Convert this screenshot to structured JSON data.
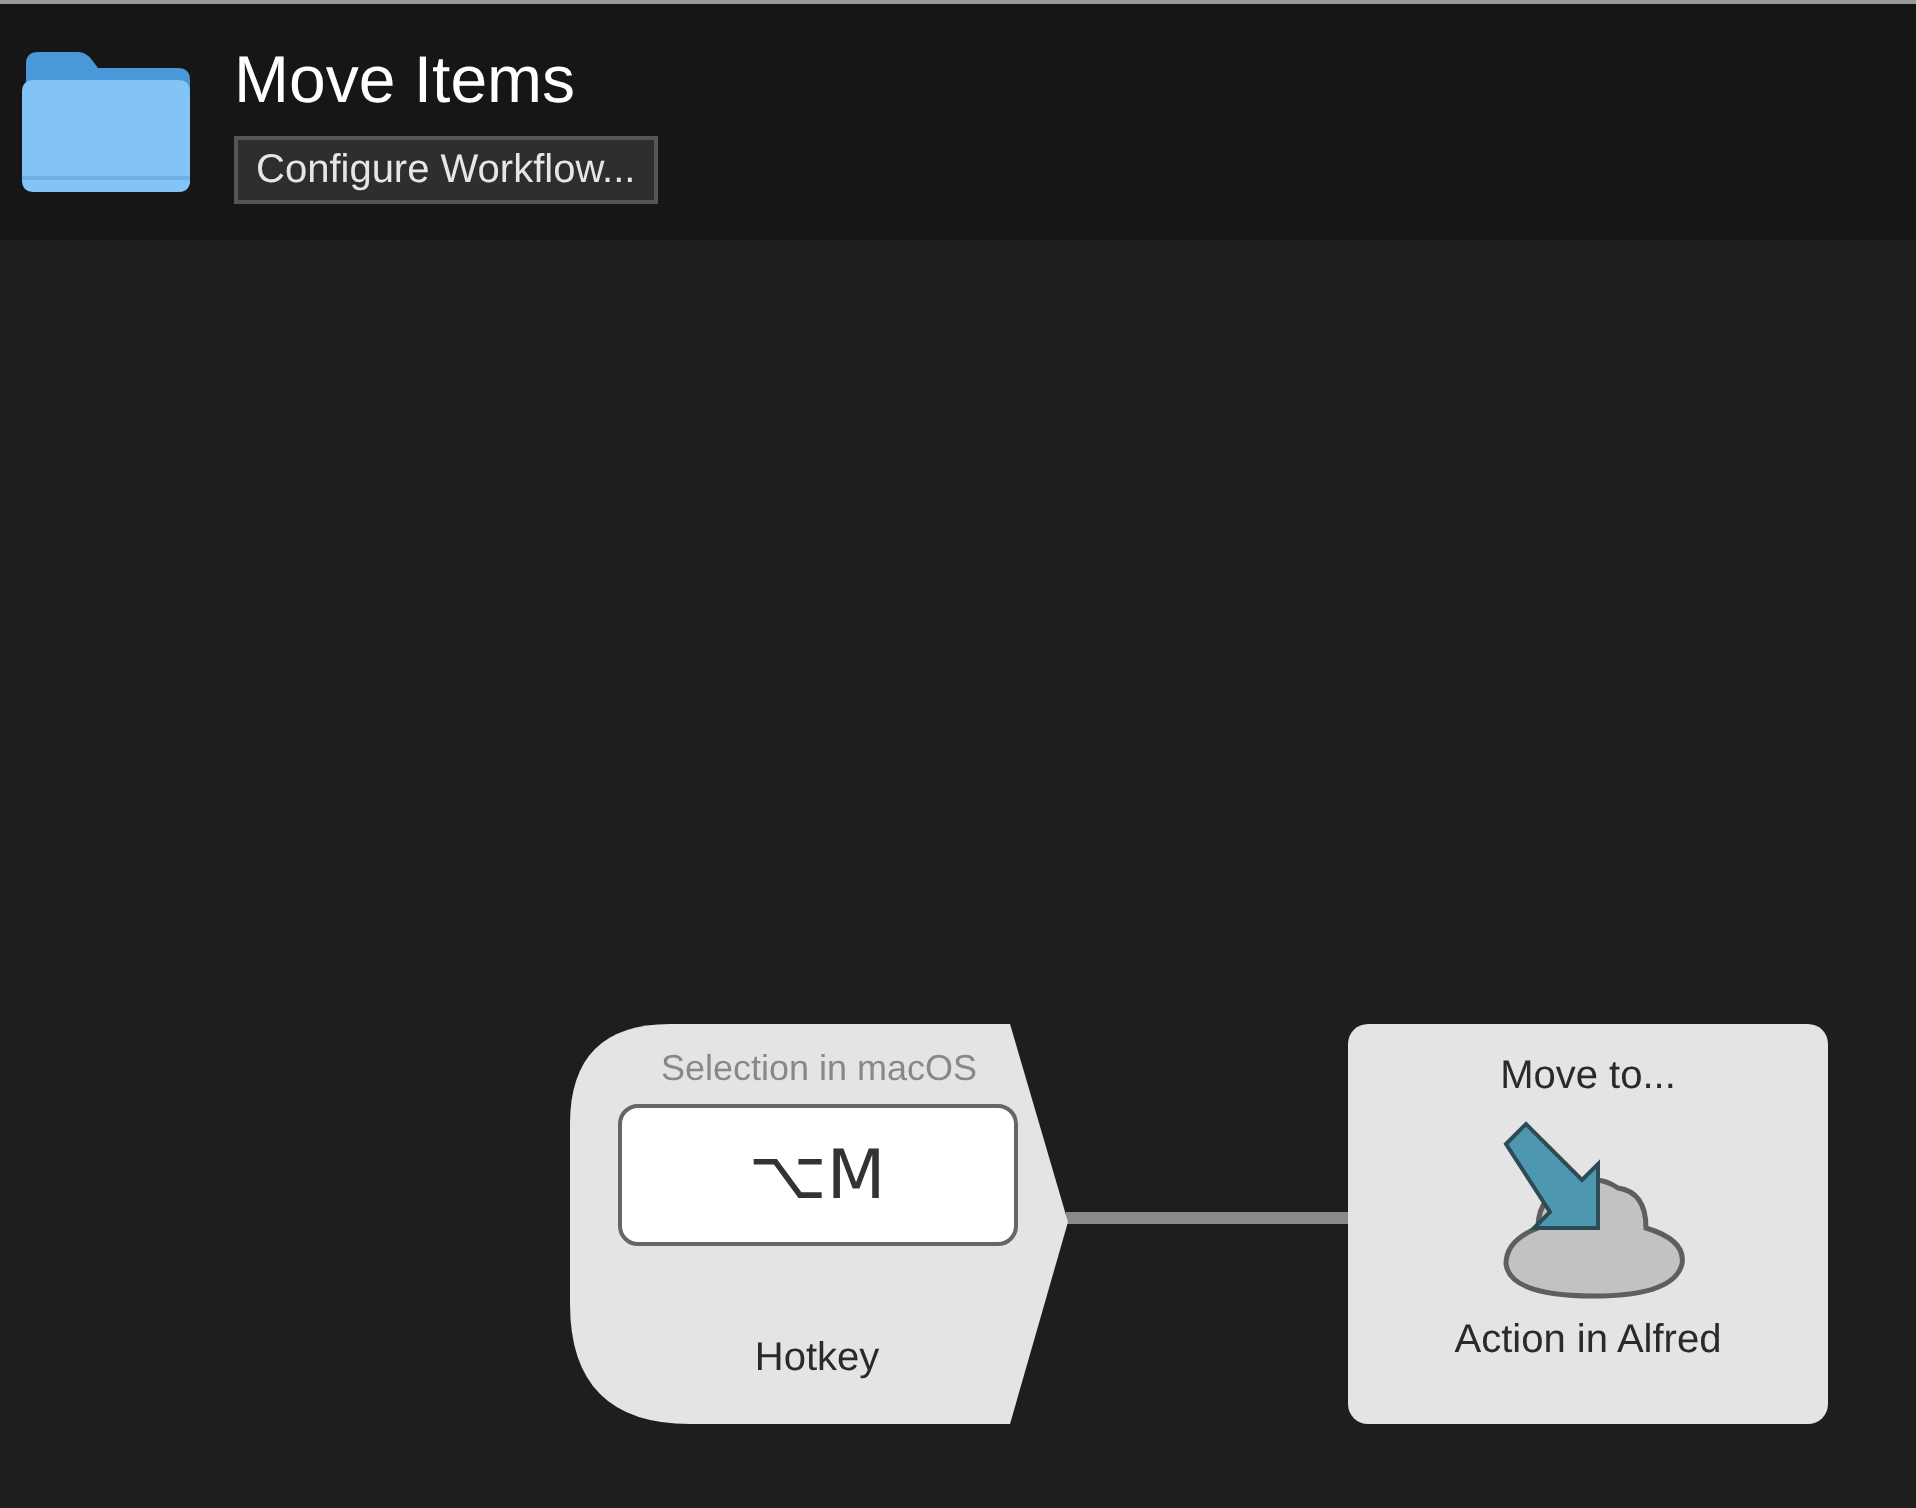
{
  "header": {
    "title": "Move Items",
    "button": "Configure Workflow..."
  },
  "nodes": [
    {
      "kind": "hotkey",
      "subtitle": "Selection in macOS",
      "key": "⌥M",
      "label": "Hotkey"
    },
    {
      "kind": "action",
      "title": "Move to...",
      "label": "Action in Alfred"
    }
  ]
}
